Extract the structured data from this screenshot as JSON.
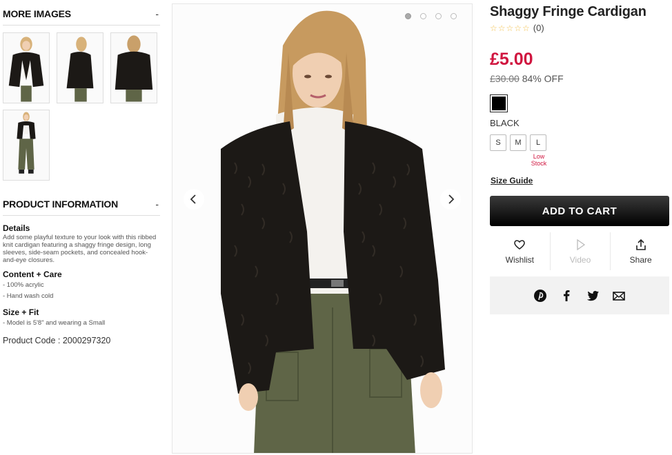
{
  "more_images": {
    "heading": "MORE IMAGES",
    "toggle": "-"
  },
  "product_info": {
    "heading": "PRODUCT INFORMATION",
    "toggle": "-",
    "details_title": "Details",
    "details_text": "Add some playful texture to your look with this ribbed knit cardigan featuring a shaggy fringe design, long sleeves, side-seam pockets, and concealed hook-and-eye closures.",
    "content_title": "Content + Care",
    "content_items": [
      "- 100% acrylic",
      "- Hand wash cold"
    ],
    "size_fit_title": "Size + Fit",
    "size_fit_items": [
      "- Model is 5'8\" and wearing a Small"
    ],
    "product_code": "Product Code : 2000297320"
  },
  "product": {
    "title": "Shaggy Fringe Cardigan",
    "stars": "☆☆☆☆☆",
    "review_count": "(0)",
    "price": "£5.00",
    "original_price": "£30.00",
    "discount": "84% OFF",
    "color_name": "BLACK",
    "sizes": [
      "S",
      "M",
      "L"
    ],
    "low_stock_label": "Low Stock",
    "size_guide": "Size Guide",
    "add_to_cart": "ADD TO CART"
  },
  "actions": {
    "wishlist": "Wishlist",
    "video": "Video",
    "share": "Share"
  },
  "colors": {
    "price_red": "#d0153f",
    "cart_black": "#000000",
    "star_yellow": "#f2c14e",
    "social_bg": "#f2f2f2"
  },
  "icons": [
    "heart-icon",
    "play-icon",
    "share-icon",
    "pinterest-icon",
    "facebook-icon",
    "twitter-icon",
    "email-icon",
    "chevron-left-icon",
    "chevron-right-icon"
  ]
}
